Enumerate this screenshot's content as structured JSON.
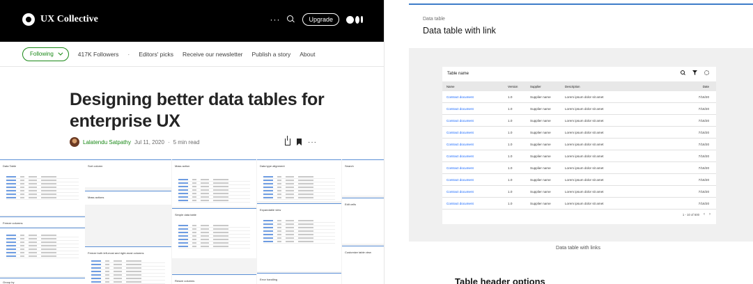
{
  "left": {
    "brand": {
      "name": "UX Collective"
    },
    "topbar": {
      "more": "···",
      "upgrade": "Upgrade"
    },
    "subnav": {
      "following": "Following",
      "followers": "417K Followers",
      "dot": "·",
      "items": [
        "Editors' picks",
        "Receive our newsletter",
        "Publish a story",
        "About"
      ]
    },
    "article": {
      "title": "Designing better data tables for enterprise UX",
      "author": "Lalatendu Satpathy",
      "date": "Jul 11, 2020",
      "sep": "·",
      "read_time": "5 min read",
      "more": "···"
    },
    "collage": {
      "cards": [
        "Data Table",
        "Sort column",
        "Mass action",
        "Data type alignment",
        "Search",
        "Freeze columns",
        "Mass actions",
        "Simple data table",
        "Expandable view",
        "Edit cells",
        "Freeze both left-most and right-most columns",
        "Customize table view",
        "Error handling",
        "Group by",
        "Resize columns"
      ]
    }
  },
  "right": {
    "eyebrow": "Data table",
    "title": "Data table with link",
    "table": {
      "name": "Table name",
      "columns": [
        "Name",
        "Version",
        "Supplier",
        "Description",
        "Date"
      ],
      "rows": [
        [
          "Contract document",
          "1.0",
          "Supplier name",
          "Lorem ipsum dolor sit amet",
          "7/16/20"
        ],
        [
          "Contract document",
          "1.0",
          "Supplier name",
          "Lorem ipsum dolor sit amet",
          "7/16/20"
        ],
        [
          "Contract document",
          "1.0",
          "Supplier name",
          "Lorem ipsum dolor sit amet",
          "7/16/20"
        ],
        [
          "Contract document",
          "1.0",
          "Supplier name",
          "Lorem ipsum dolor sit amet",
          "7/16/20"
        ],
        [
          "Contract document",
          "1.0",
          "Supplier name",
          "Lorem ipsum dolor sit amet",
          "7/16/20"
        ],
        [
          "Contract document",
          "1.0",
          "Supplier name",
          "Lorem ipsum dolor sit amet",
          "7/16/20"
        ],
        [
          "Contract document",
          "1.0",
          "Supplier name",
          "Lorem ipsum dolor sit amet",
          "7/16/20"
        ],
        [
          "Contract document",
          "1.0",
          "Supplier name",
          "Lorem ipsum dolor sit amet",
          "7/16/20"
        ],
        [
          "Contract document",
          "1.0",
          "Supplier name",
          "Lorem ipsum dolor sit amet",
          "7/16/20"
        ],
        [
          "Contract document",
          "1.0",
          "Supplier name",
          "Lorem ipsum dolor sit amet",
          "7/16/20"
        ]
      ],
      "pagination": "1 - 10 of 500",
      "prev": "‹",
      "next": "›"
    },
    "caption": "Data table with links",
    "next_heading": "Table header options"
  },
  "colors": {
    "accent_green": "#1a8917",
    "link_blue": "#0f62fe",
    "accent_rule": "#3d7cc9"
  }
}
